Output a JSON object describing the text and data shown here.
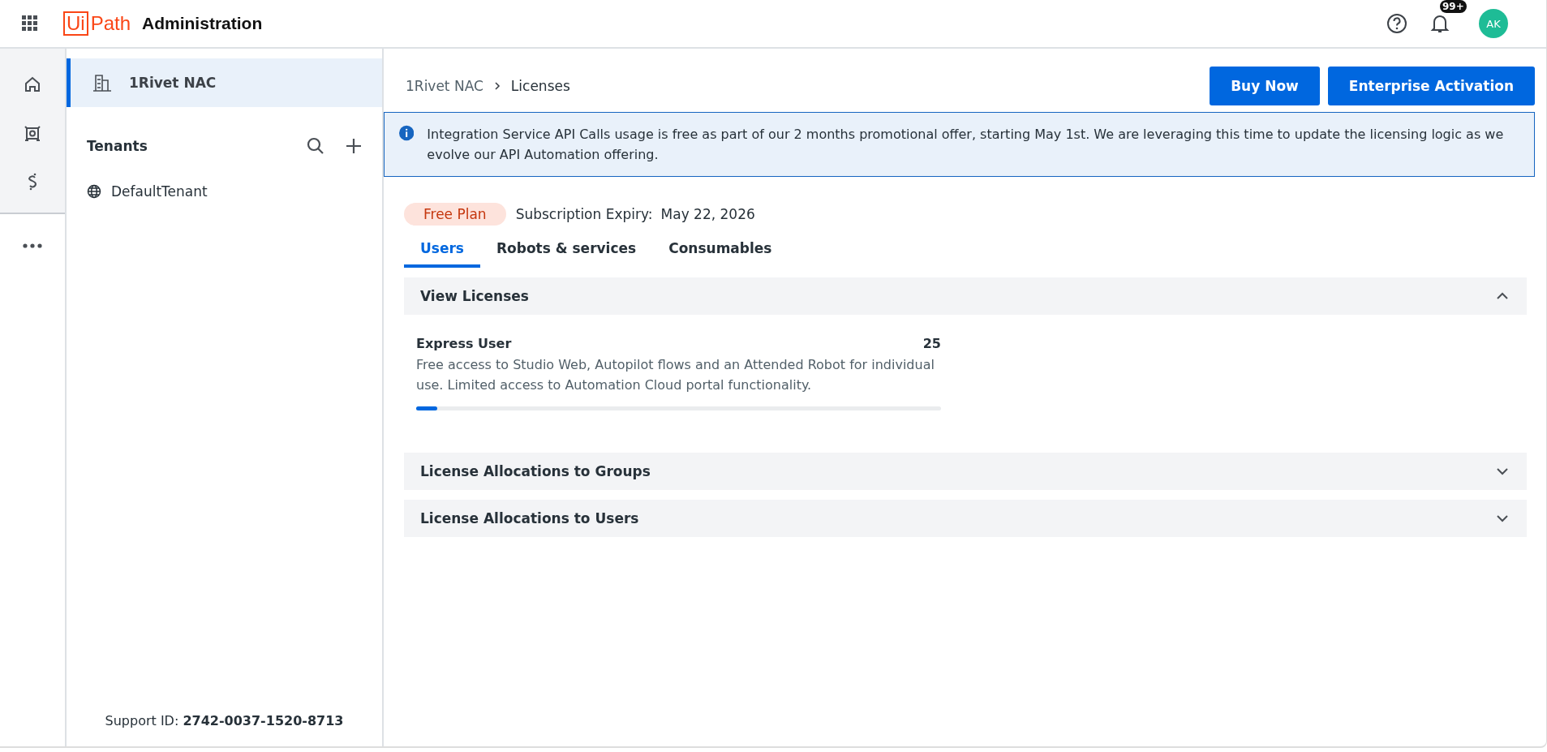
{
  "header": {
    "logo_boxed": "Ui",
    "logo_rest": "Path",
    "title": "Administration",
    "notification_badge": "99+",
    "avatar": "AK"
  },
  "rail": {
    "items": [
      {
        "kind": "home",
        "selected": false
      },
      {
        "kind": "robot",
        "selected": false
      },
      {
        "kind": "link",
        "selected": false
      }
    ]
  },
  "sidebar": {
    "org": {
      "label": "1Rivet NAC",
      "selected": true
    },
    "tenants_title": "Tenants",
    "tenants": [
      {
        "label": "DefaultTenant",
        "selected": false
      }
    ],
    "support_label": "Support ID:",
    "support_id": "2742-0037-1520-8713"
  },
  "breadcrumb": [
    "1Rivet NAC",
    "Licenses"
  ],
  "buttons": [
    "Buy Now",
    "Enterprise Activation"
  ],
  "banner": "Integration Service API Calls usage is free as part of our 2 months promotional offer, starting May 1st. We are leveraging this time to update the licensing logic as we evolve our API Automation offering.",
  "plan": {
    "badge": "Free Plan",
    "expiry_label": "Subscription Expiry:",
    "expiry_date": "May 22, 2026"
  },
  "tabs": [
    {
      "label": "Users",
      "selected": true
    },
    {
      "label": "Robots & services",
      "selected": false
    },
    {
      "label": "Consumables",
      "selected": false
    }
  ],
  "sections": [
    {
      "title": "View Licenses",
      "expanded": true,
      "licenses": [
        {
          "name": "Express User",
          "count": "25",
          "description": "Free access to Studio Web, Autopilot flows and an Attended Robot for individual use. Limited access to Automation Cloud portal functionality.",
          "level": 0.04
        }
      ]
    },
    {
      "title": "License Allocations to Groups",
      "expanded": false
    },
    {
      "title": "License Allocations to Users",
      "expanded": false
    }
  ]
}
